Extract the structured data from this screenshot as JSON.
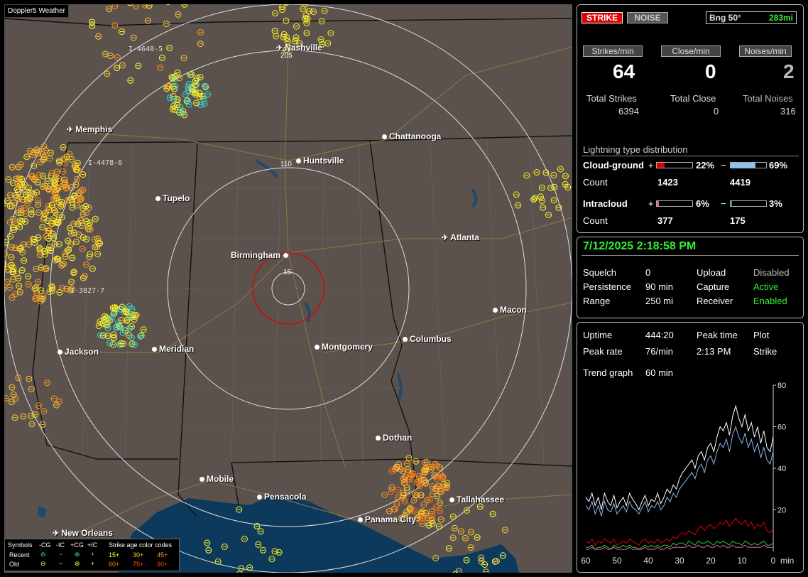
{
  "app_title": "Doppler5 Weather",
  "map": {
    "cities": [
      {
        "name": "Nashville",
        "type": "airport"
      },
      {
        "name": "Memphis",
        "type": "airport"
      },
      {
        "name": "Chattanooga",
        "type": "dot"
      },
      {
        "name": "Huntsville",
        "type": "dot"
      },
      {
        "name": "Tupelo",
        "type": "dot"
      },
      {
        "name": "Atlanta",
        "type": "airport"
      },
      {
        "name": "Birmingham",
        "type": "dot"
      },
      {
        "name": "Macon",
        "type": "dot"
      },
      {
        "name": "Columbus",
        "type": "dot"
      },
      {
        "name": "Montgomery",
        "type": "dot"
      },
      {
        "name": "Meridian",
        "type": "dot"
      },
      {
        "name": "Jackson",
        "type": "dot"
      },
      {
        "name": "Dothan",
        "type": "dot"
      },
      {
        "name": "Mobile",
        "type": "dot"
      },
      {
        "name": "Pensacola",
        "type": "dot"
      },
      {
        "name": "Tallahassee",
        "type": "dot"
      },
      {
        "name": "Panama City",
        "type": "dot"
      },
      {
        "name": "New Orleans",
        "type": "airport"
      }
    ],
    "range_labels": [
      "205",
      "110",
      "15"
    ],
    "interstate_labels": [
      "I-4648-5",
      "I-4478-6",
      "I-3827-7"
    ]
  },
  "legend": {
    "title_symbols": "Symbols",
    "cols": [
      "-CG",
      "-IC",
      "+CG",
      "+IC"
    ],
    "title_age": "Strike age color codes",
    "recent_label": "Recent",
    "old_label": "Old",
    "recent_ages": [
      "15+",
      "30+",
      "45+"
    ],
    "old_ages": [
      "60+",
      "75+",
      "90+"
    ],
    "recent_symbols": [
      "⊖",
      "−",
      "⊕",
      "+"
    ],
    "old_symbols": [
      "⊖",
      "−",
      "⊕",
      "+"
    ]
  },
  "status": {
    "strike_label": "STRIKE",
    "noise_label": "NOISE",
    "bearing_label": "Bng 50°",
    "bearing_distance": "283mi"
  },
  "rates": {
    "strikes_per_min_label": "Strikes/min",
    "close_per_min_label": "Close/min",
    "noises_per_min_label": "Noises/min",
    "strikes_per_min": "64",
    "close_per_min": "0",
    "noises_per_min": "2",
    "total_strikes_label": "Total Strikes",
    "total_close_label": "Total Close",
    "total_noises_label": "Total Noises",
    "total_strikes": "6394",
    "total_close": "0",
    "total_noises": "316"
  },
  "distribution": {
    "title": "Lightning type distribution",
    "cg_label": "Cloud-ground",
    "ic_label": "Intracloud",
    "count_label": "Count",
    "plus": "+",
    "minus": "−",
    "cg_pos_pct": "22%",
    "cg_neg_pct": "69%",
    "cg_pos_count": "1423",
    "cg_neg_count": "4419",
    "ic_pos_pct": "6%",
    "ic_neg_pct": "3%",
    "ic_pos_count": "377",
    "ic_neg_count": "175",
    "cg_pos_fill": 0.22,
    "cg_neg_fill": 0.69,
    "ic_pos_fill": 0.06,
    "ic_neg_fill": 0.03,
    "colors": {
      "cg_pos": "#e00000",
      "cg_neg": "#88c4f0",
      "ic_pos": "#e060a0",
      "ic_neg": "#22aa44"
    }
  },
  "settings": {
    "datetime": "7/12/2025 2:18:58 PM",
    "squelch_label": "Squelch",
    "squelch": "0",
    "persistence_label": "Persistence",
    "persistence": "90 min",
    "range_label": "Range",
    "range": "250 mi",
    "upload_label": "Upload",
    "upload": "Disabled",
    "capture_label": "Capture",
    "capture": "Active",
    "receiver_label": "Receiver",
    "receiver": "Enabled"
  },
  "stats": {
    "uptime_label": "Uptime",
    "uptime": "444:20",
    "peak_time_label": "Peak time",
    "plot_label": "Plot",
    "peak_rate_label": "Peak rate",
    "peak_rate": "76/min",
    "peak_time": "2:13 PM",
    "plot": "Strike",
    "trend_label": "Trend graph",
    "trend": "60 min"
  },
  "chart_data": {
    "type": "line",
    "x_ticks": [
      "60",
      "50",
      "40",
      "30",
      "20",
      "10",
      "0"
    ],
    "x_unit": "min",
    "y_ticks": [
      "20",
      "40",
      "60",
      "80"
    ],
    "ylim": [
      0,
      80
    ],
    "xlim": [
      60,
      0
    ],
    "series": [
      {
        "color": "#ffffff",
        "values": [
          26,
          24,
          28,
          22,
          26,
          20,
          28,
          24,
          22,
          27,
          21,
          24,
          26,
          22,
          28,
          25,
          23,
          20,
          24,
          27,
          22,
          25,
          24,
          28,
          23,
          26,
          30,
          28,
          32,
          30,
          35,
          38,
          40,
          42,
          44,
          40,
          46,
          48,
          44,
          50,
          52,
          48,
          55,
          60,
          58,
          62,
          56,
          65,
          70,
          64,
          60,
          66,
          58,
          62,
          55,
          60,
          52,
          58,
          50,
          48,
          55
        ]
      },
      {
        "color": "#8ab8ea",
        "values": [
          22,
          20,
          24,
          18,
          22,
          17,
          24,
          20,
          19,
          23,
          18,
          20,
          22,
          19,
          24,
          21,
          20,
          18,
          21,
          24,
          19,
          22,
          21,
          24,
          20,
          22,
          26,
          24,
          28,
          26,
          30,
          32,
          34,
          36,
          38,
          35,
          40,
          42,
          38,
          44,
          46,
          42,
          48,
          52,
          50,
          54,
          48,
          56,
          60,
          55,
          52,
          57,
          50,
          54,
          48,
          52,
          45,
          50,
          44,
          42,
          48
        ]
      },
      {
        "color": "#e00000",
        "values": [
          5,
          4,
          6,
          3,
          5,
          4,
          6,
          5,
          4,
          6,
          3,
          4,
          5,
          4,
          6,
          5,
          4,
          3,
          5,
          6,
          4,
          5,
          4,
          6,
          4,
          5,
          6,
          5,
          7,
          6,
          8,
          9,
          8,
          10,
          9,
          8,
          11,
          12,
          10,
          12,
          13,
          11,
          12,
          14,
          13,
          15,
          12,
          14,
          16,
          14,
          13,
          15,
          12,
          14,
          11,
          13,
          12,
          14,
          10,
          9,
          11
        ]
      },
      {
        "color": "#22cc44",
        "values": [
          2,
          2,
          3,
          1,
          2,
          2,
          3,
          2,
          1,
          3,
          2,
          2,
          3,
          2,
          3,
          2,
          2,
          1,
          2,
          3,
          2,
          3,
          2,
          3,
          2,
          3,
          3,
          2,
          4,
          3,
          4,
          4,
          3,
          5,
          4,
          3,
          5,
          4,
          4,
          5,
          4,
          3,
          5,
          4,
          5,
          4,
          3,
          5,
          4,
          4,
          3,
          5,
          4,
          3,
          4,
          3,
          4,
          5,
          3,
          3,
          4
        ]
      },
      {
        "color": "#e060a0",
        "values": [
          1,
          1,
          2,
          1,
          1,
          1,
          2,
          1,
          1,
          2,
          1,
          1,
          1,
          1,
          2,
          1,
          1,
          1,
          1,
          2,
          1,
          1,
          1,
          2,
          1,
          1,
          2,
          1,
          2,
          2,
          2,
          2,
          2,
          3,
          2,
          2,
          3,
          2,
          2,
          3,
          2,
          2,
          3,
          2,
          3,
          2,
          2,
          3,
          2,
          2,
          2,
          3,
          2,
          2,
          2,
          2,
          2,
          3,
          2,
          2,
          2
        ]
      }
    ]
  }
}
